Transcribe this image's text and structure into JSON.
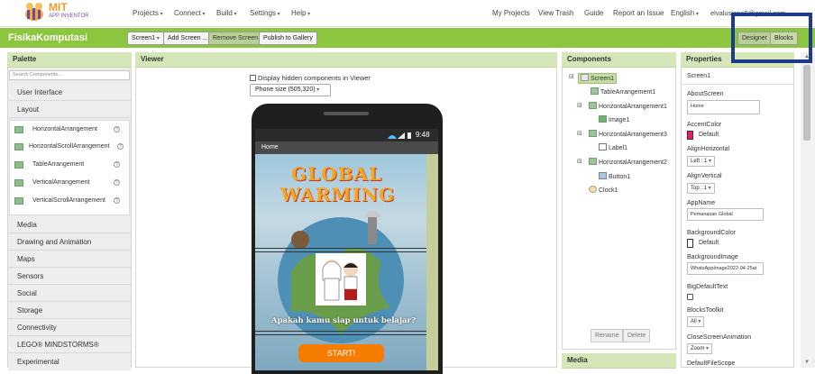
{
  "nav": {
    "logo_top": "MIT",
    "logo_bottom": "APP INVENTOR",
    "menus": [
      "Projects",
      "Connect",
      "Build",
      "Settings",
      "Help"
    ],
    "right_links": [
      "My Projects",
      "View Trash",
      "Guide",
      "Report an Issue"
    ],
    "language": "English",
    "account": "elvalusiana9@gmail.com"
  },
  "project": {
    "name": "FisikaKomputasi",
    "screen_select": "Screen1",
    "add_screen": "Add Screen ...",
    "remove_screen": "Remove Screen",
    "publish": "Publish to Gallery",
    "designer": "Designer",
    "blocks": "Blocks"
  },
  "palette": {
    "title": "Palette",
    "search_placeholder": "Search Components...",
    "categories_top": [
      "User Interface",
      "Layout"
    ],
    "layout_items": [
      "HorizontalArrangement",
      "HorizontalScrollArrangement",
      "TableArrangement",
      "VerticalArrangement",
      "VerticalScrollArrangement"
    ],
    "help_glyph": "?",
    "categories_bottom": [
      "Media",
      "Drawing and Animation",
      "Maps",
      "Sensors",
      "Social",
      "Storage",
      "Connectivity",
      "LEGO® MINDSTORMS®",
      "Experimental"
    ]
  },
  "viewer": {
    "title": "Viewer",
    "hidden_checkbox": "Display hidden components in Viewer",
    "phone_size": "Phone size (505,320)",
    "clock": "9:48",
    "screen_title": "Home",
    "banner_line1": "GLOBAL",
    "banner_line2": "WARMING",
    "question": "Apakah kamu siap untuk belajar?",
    "start_button": "START!"
  },
  "components": {
    "title": "Components",
    "tree": [
      "Screen1",
      "TableArrangement1",
      "HorizontalArrangement1",
      "Image1",
      "HorizontalArrangement3",
      "Label1",
      "HorizontalArrangement2",
      "Button1",
      "Clock1"
    ],
    "rename": "Rename",
    "delete": "Delete",
    "media": "Media"
  },
  "properties": {
    "title": "Properties",
    "screen": "Screen1",
    "about_label": "AboutScreen",
    "about_value": "Home",
    "accent_label": "AccentColor",
    "accent_value": "Default",
    "accent_color": "#e91e63",
    "align_h_label": "AlignHorizontal",
    "align_h_value": "Left : 1",
    "align_v_label": "AlignVertical",
    "align_v_value": "Top : 1",
    "appname_label": "AppName",
    "appname_value": "Pemanasan Global",
    "bgcolor_label": "BackgroundColor",
    "bgcolor_value": "Default",
    "bgimage_label": "BackgroundImage",
    "bgimage_value": "WhatsAppImage2022-04-25at",
    "bigfont_label": "BigDefaultText",
    "toolkit_label": "BlocksToolkit",
    "toolkit_value": "All",
    "closeanim_label": "CloseScreenAnimation",
    "closeanim_value": "Zoom",
    "filescope_label": "DefaultFileScope"
  }
}
